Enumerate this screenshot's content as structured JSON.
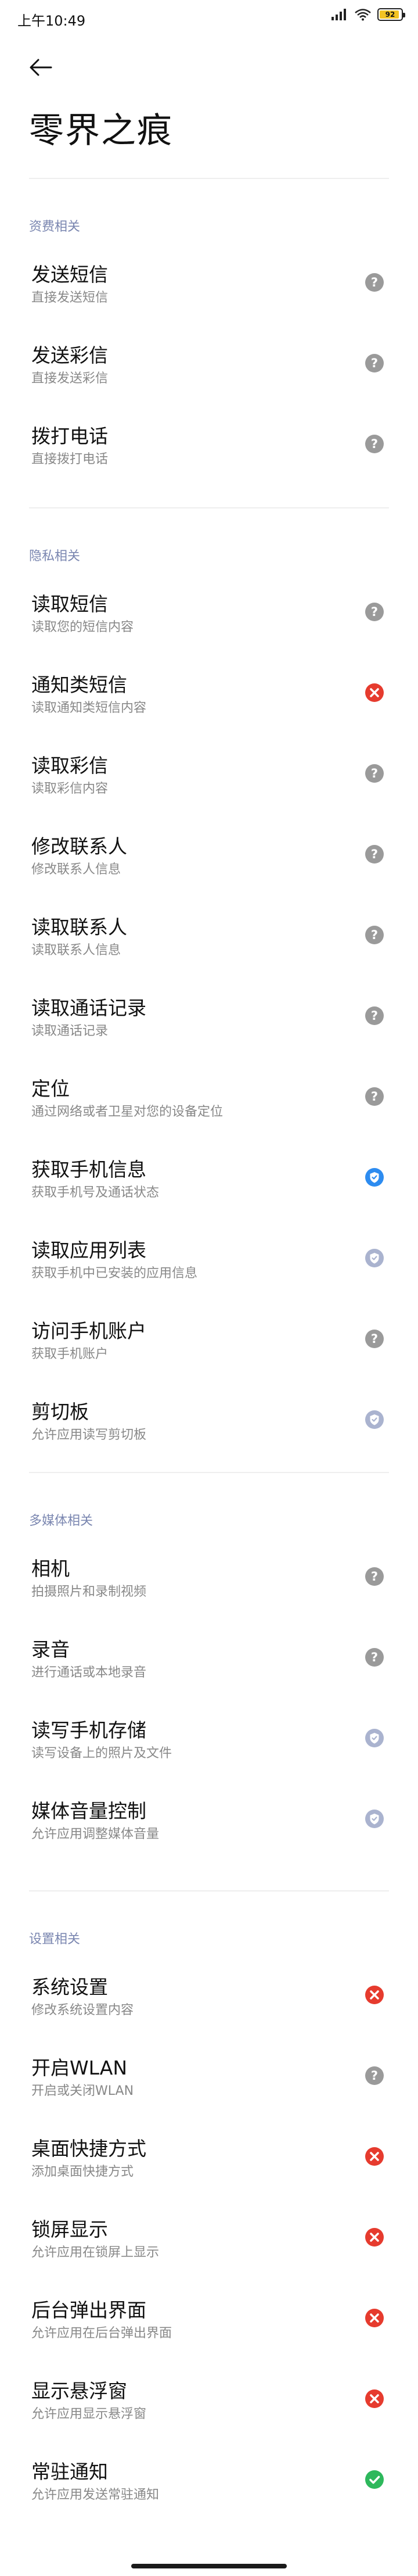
{
  "status_bar": {
    "time": "上午10:49",
    "battery_level": "92"
  },
  "page": {
    "title": "零界之痕"
  },
  "colors": {
    "ask": "#9a9a9a",
    "deny": "#e63b2e",
    "allow": "#2eb85c",
    "foreground_only": "#2d8cf0",
    "foreground_only_disabled": "#aab3cf",
    "section_header": "#7a86b0"
  },
  "sections": [
    {
      "header": "资费相关",
      "items": [
        {
          "title": "发送短信",
          "subtitle": "直接发送短信",
          "status": "ask"
        },
        {
          "title": "发送彩信",
          "subtitle": "直接发送彩信",
          "status": "ask"
        },
        {
          "title": "拨打电话",
          "subtitle": "直接拨打电话",
          "status": "ask"
        }
      ]
    },
    {
      "header": "隐私相关",
      "items": [
        {
          "title": "读取短信",
          "subtitle": "读取您的短信内容",
          "status": "ask"
        },
        {
          "title": "通知类短信",
          "subtitle": "读取通知类短信内容",
          "status": "deny"
        },
        {
          "title": "读取彩信",
          "subtitle": "读取彩信内容",
          "status": "ask"
        },
        {
          "title": "修改联系人",
          "subtitle": "修改联系人信息",
          "status": "ask"
        },
        {
          "title": "读取联系人",
          "subtitle": "读取联系人信息",
          "status": "ask"
        },
        {
          "title": "读取通话记录",
          "subtitle": "读取通话记录",
          "status": "ask"
        },
        {
          "title": "定位",
          "subtitle": "通过网络或者卫星对您的设备定位",
          "status": "ask"
        },
        {
          "title": "获取手机信息",
          "subtitle": "获取手机号及通话状态",
          "status": "foreground_only"
        },
        {
          "title": "读取应用列表",
          "subtitle": "获取手机中已安装的应用信息",
          "status": "foreground_only_disabled"
        },
        {
          "title": "访问手机账户",
          "subtitle": "获取手机账户",
          "status": "ask"
        },
        {
          "title": "剪切板",
          "subtitle": "允许应用读写剪切板",
          "status": "foreground_only_disabled"
        }
      ]
    },
    {
      "header": "多媒体相关",
      "items": [
        {
          "title": "相机",
          "subtitle": "拍摄照片和录制视频",
          "status": "ask"
        },
        {
          "title": "录音",
          "subtitle": "进行通话或本地录音",
          "status": "ask"
        },
        {
          "title": "读写手机存储",
          "subtitle": "读写设备上的照片及文件",
          "status": "foreground_only_disabled"
        },
        {
          "title": "媒体音量控制",
          "subtitle": "允许应用调整媒体音量",
          "status": "foreground_only_disabled"
        }
      ]
    },
    {
      "header": "设置相关",
      "items": [
        {
          "title": "系统设置",
          "subtitle": "修改系统设置内容",
          "status": "deny"
        },
        {
          "title": "开启WLAN",
          "subtitle": "开启或关闭WLAN",
          "status": "ask"
        },
        {
          "title": "桌面快捷方式",
          "subtitle": "添加桌面快捷方式",
          "status": "deny"
        },
        {
          "title": "锁屏显示",
          "subtitle": "允许应用在锁屏上显示",
          "status": "deny"
        },
        {
          "title": "后台弹出界面",
          "subtitle": "允许应用在后台弹出界面",
          "status": "deny"
        },
        {
          "title": "显示悬浮窗",
          "subtitle": "允许应用显示悬浮窗",
          "status": "deny"
        },
        {
          "title": "常驻通知",
          "subtitle": "允许应用发送常驻通知",
          "status": "allow"
        }
      ]
    }
  ]
}
